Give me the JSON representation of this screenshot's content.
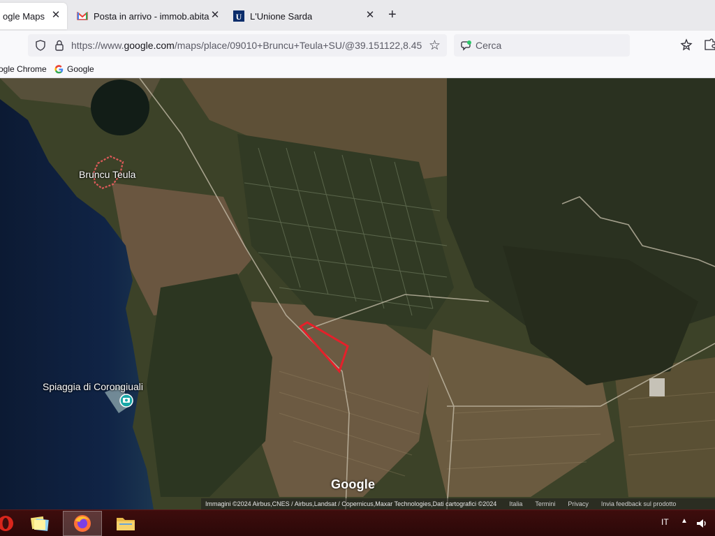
{
  "browser": {
    "tabs": [
      {
        "label": "ogle Maps",
        "active": true,
        "icon": "google-maps-icon"
      },
      {
        "label": "Posta in arrivo - immob.abitare",
        "active": false,
        "icon": "gmail-icon"
      },
      {
        "label": "L'Unione Sarda",
        "active": false,
        "icon": "unione-sarda-icon"
      }
    ],
    "url_prefix": "https://www.",
    "url_domain": "google.com",
    "url_path": "/maps/place/09010+Bruncu+Teula+SU/@39.151122,8.45",
    "search_placeholder": "Cerca",
    "bookmarks": [
      {
        "label": "ogle Chrome",
        "icon": "none"
      },
      {
        "label": "Google",
        "icon": "google-g-icon"
      }
    ]
  },
  "map": {
    "labels": {
      "town": "Bruncu Teula",
      "beach": "Spiaggia di Corongiuali"
    },
    "logo": "Google",
    "attribution": "Immagini ©2024 Airbus,CNES / Airbus,Landsat / Copernicus,Maxar Technologies,Dati cartografici ©2024",
    "footer_links": [
      "Italia",
      "Termini",
      "Privacy",
      "Invia feedback sul prodotto"
    ],
    "highlight_color": "#e5202a",
    "town_outline_color": "#e05a5a"
  },
  "taskbar": {
    "language": "IT",
    "accent": "#3e0d0d"
  }
}
